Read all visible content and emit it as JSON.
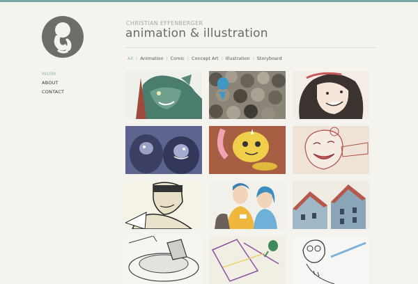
{
  "site": {
    "subtitle": "CHRISTIAN EFFENBERGER",
    "title": "animation & illustration"
  },
  "nav": {
    "items": [
      {
        "label": "WORK",
        "active": true
      },
      {
        "label": "ABOUT",
        "active": false
      },
      {
        "label": "CONTACT",
        "active": false
      }
    ]
  },
  "filters": {
    "items": [
      "All",
      "Animation",
      "Comic",
      "Concept Art",
      "Illustration",
      "Storyboard"
    ],
    "active": "All"
  },
  "gallery": {
    "thumbnails": [
      {
        "subject": "green-monster-illustration"
      },
      {
        "subject": "crowd-with-blue-bird"
      },
      {
        "subject": "smiling-girl-sketch"
      },
      {
        "subject": "gorillas-scene"
      },
      {
        "subject": "yellow-creature-cartoon"
      },
      {
        "subject": "laughing-girl-sketch"
      },
      {
        "subject": "comic-character-with-goggles"
      },
      {
        "subject": "couple-with-dog"
      },
      {
        "subject": "houses-isometric"
      },
      {
        "subject": "vehicle-sketch"
      },
      {
        "subject": "purple-lines-sketch"
      },
      {
        "subject": "character-with-glasses-sketch"
      }
    ]
  },
  "colors": {
    "background": "#f4f3ee",
    "accent": "#8fb7b3",
    "topbar": "#7aa6a4",
    "logo": "#6e6d6a"
  }
}
